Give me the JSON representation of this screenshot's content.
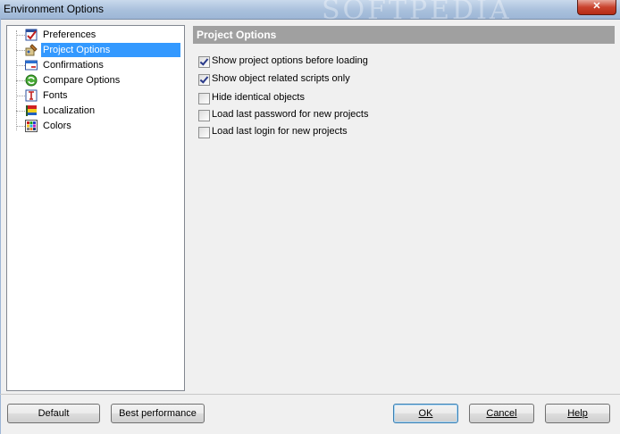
{
  "window": {
    "title": "Environment Options",
    "watermark": "SOFTPEDIA",
    "close_glyph": "✕"
  },
  "tree": {
    "items": [
      {
        "label": "Preferences",
        "icon": "preferences-icon"
      },
      {
        "label": "Project Options",
        "icon": "project-options-icon",
        "selected": true
      },
      {
        "label": "Confirmations",
        "icon": "confirmations-icon"
      },
      {
        "label": "Compare Options",
        "icon": "compare-options-icon"
      },
      {
        "label": "Fonts",
        "icon": "fonts-icon"
      },
      {
        "label": "Localization",
        "icon": "localization-icon"
      },
      {
        "label": "Colors",
        "icon": "colors-icon"
      }
    ]
  },
  "panel": {
    "header": "Project Options",
    "options": [
      {
        "label": "Show project options before loading",
        "checked": true
      },
      {
        "label": "Show object related scripts only",
        "checked": true
      },
      {
        "label": "Hide identical objects",
        "checked": false
      },
      {
        "label": "Load last password for new projects",
        "checked": false
      },
      {
        "label": "Load last login for new projects",
        "checked": false
      }
    ]
  },
  "buttons": {
    "default": "Default",
    "best_performance": "Best performance",
    "ok": "OK",
    "cancel": "Cancel",
    "help": "Help"
  },
  "colors": {
    "selection": "#3399ff",
    "panel_header_bg": "#a0a0a0"
  }
}
